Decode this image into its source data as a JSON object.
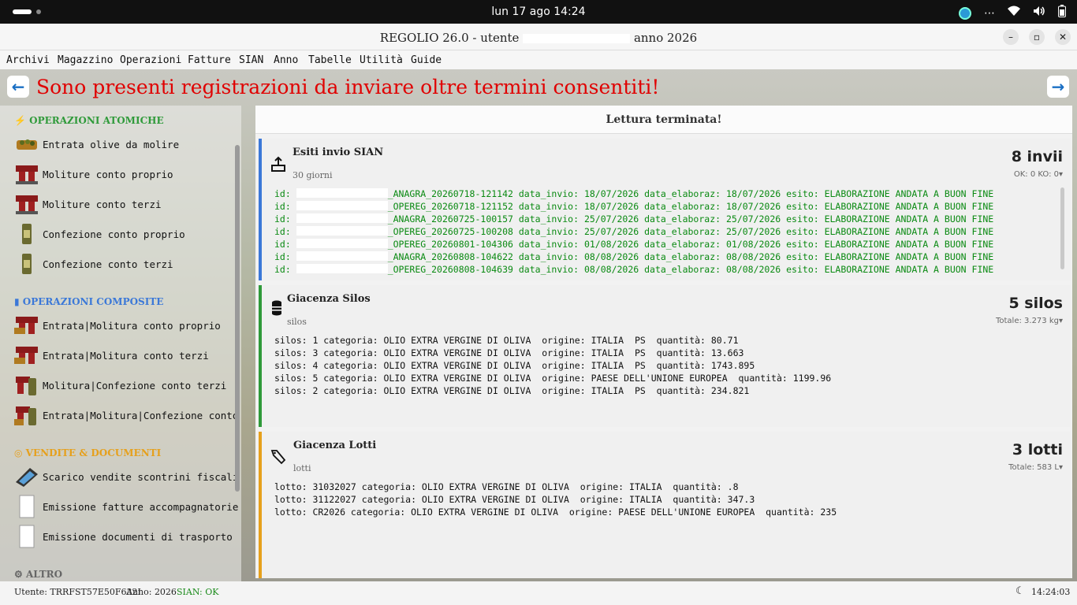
{
  "system_bar": {
    "clock": "lun 17 ago  14:24"
  },
  "window": {
    "title_left": "REGOLIO 26.0 - utente",
    "title_right": "anno 2026"
  },
  "menu": [
    "Archivi",
    "Magazzino",
    "Operazioni",
    "Fatture",
    "SIAN",
    "Anno",
    "Tabelle",
    "Utilità",
    "Guide"
  ],
  "banner": "Sono presenti registrazioni da inviare oltre termini consentiti!",
  "sidebar": {
    "sections": [
      {
        "label": "OPERAZIONI ATOMICHE",
        "color": "#2f9a3a",
        "icon": "bolt-icon"
      },
      {
        "label": "OPERAZIONI COMPOSITE",
        "color": "#3b78d8",
        "icon": "square-icon"
      },
      {
        "label": "VENDITE & DOCUMENTI",
        "color": "#e6a01c",
        "icon": "circle-icon"
      },
      {
        "label": "ALTRO",
        "color": "#666666",
        "icon": "gear-icon"
      }
    ],
    "items": [
      "Entrata olive da molire",
      "Moliture conto proprio",
      "Moliture conto terzi",
      "Confezione conto proprio",
      "Confezione conto terzi",
      "Entrata|Molitura conto proprio",
      "Entrata|Molitura conto terzi",
      "Molitura|Confezione conto terzi",
      "Entrata|Molitura|Confezione conto t",
      "Scarico vendite scontrini fiscali",
      "Emissione fatture accompagnatorie",
      "Emissione documenti di trasporto"
    ]
  },
  "panel": {
    "header": "Lettura terminata!",
    "sian": {
      "title": "Esiti invio SIAN",
      "subtitle": "30 giorni",
      "count": "8 invii",
      "summary": "OK: 0  KO: 0▾",
      "color": "#3b78d8",
      "lines": [
        {
          "prefix": "id: ",
          "rest": "_ANAGRA_20260718-121142 data_invio: 18/07/2026 data_elaboraz: 18/07/2026 esito: ELABORAZIONE ANDATA A BUON FINE"
        },
        {
          "prefix": "id: ",
          "rest": "_OPEREG_20260718-121152 data_invio: 18/07/2026 data_elaboraz: 18/07/2026 esito: ELABORAZIONE ANDATA A BUON FINE"
        },
        {
          "prefix": "id: ",
          "rest": "_ANAGRA_20260725-100157 data_invio: 25/07/2026 data_elaboraz: 25/07/2026 esito: ELABORAZIONE ANDATA A BUON FINE"
        },
        {
          "prefix": "id: ",
          "rest": "_OPEREG_20260725-100208 data_invio: 25/07/2026 data_elaboraz: 25/07/2026 esito: ELABORAZIONE ANDATA A BUON FINE"
        },
        {
          "prefix": "id: ",
          "rest": "_OPEREG_20260801-104306 data_invio: 01/08/2026 data_elaboraz: 01/08/2026 esito: ELABORAZIONE ANDATA A BUON FINE"
        },
        {
          "prefix": "id: ",
          "rest": "_ANAGRA_20260808-104622 data_invio: 08/08/2026 data_elaboraz: 08/08/2026 esito: ELABORAZIONE ANDATA A BUON FINE"
        },
        {
          "prefix": "id: ",
          "rest": "_OPEREG_20260808-104639 data_invio: 08/08/2026 data_elaboraz: 08/08/2026 esito: ELABORAZIONE ANDATA A BUON FINE"
        }
      ]
    },
    "silos": {
      "title": "Giacenza Silos",
      "subtitle": "silos",
      "count": "5 silos",
      "summary": "Totale: 3.273 kg▾",
      "color": "#2f9a3a",
      "lines": [
        "silos: 1 categoria: OLIO EXTRA VERGINE DI OLIVA  origine: ITALIA  PS  quantità: 80.71",
        "silos: 3 categoria: OLIO EXTRA VERGINE DI OLIVA  origine: ITALIA  PS  quantità: 13.663",
        "silos: 4 categoria: OLIO EXTRA VERGINE DI OLIVA  origine: ITALIA  PS  quantità: 1743.895",
        "silos: 5 categoria: OLIO EXTRA VERGINE DI OLIVA  origine: PAESE DELL'UNIONE EUROPEA  quantità: 1199.96",
        "silos: 2 categoria: OLIO EXTRA VERGINE DI OLIVA  origine: ITALIA  PS  quantità: 234.821"
      ]
    },
    "lotti": {
      "title": "Giacenza Lotti",
      "subtitle": "lotti",
      "count": "3 lotti",
      "summary": "Totale: 583 L▾",
      "color": "#e6a01c",
      "lines": [
        "lotto: 31032027 categoria: OLIO EXTRA VERGINE DI OLIVA  origine: ITALIA  quantità: .8",
        "lotto: 31122027 categoria: OLIO EXTRA VERGINE DI OLIVA  origine: ITALIA  quantità: 347.3",
        "lotto: CR2026 categoria: OLIO EXTRA VERGINE DI OLIVA  origine: PAESE DELL'UNIONE EUROPEA  quantità: 235"
      ]
    }
  },
  "statusbar": {
    "user": "Utente: TRRFST57E50F632I",
    "year": "Anno: 2026",
    "sian": "SIAN: OK",
    "sian_color": "#1a8a1a",
    "moon": "☾",
    "time": "14:24:03"
  }
}
